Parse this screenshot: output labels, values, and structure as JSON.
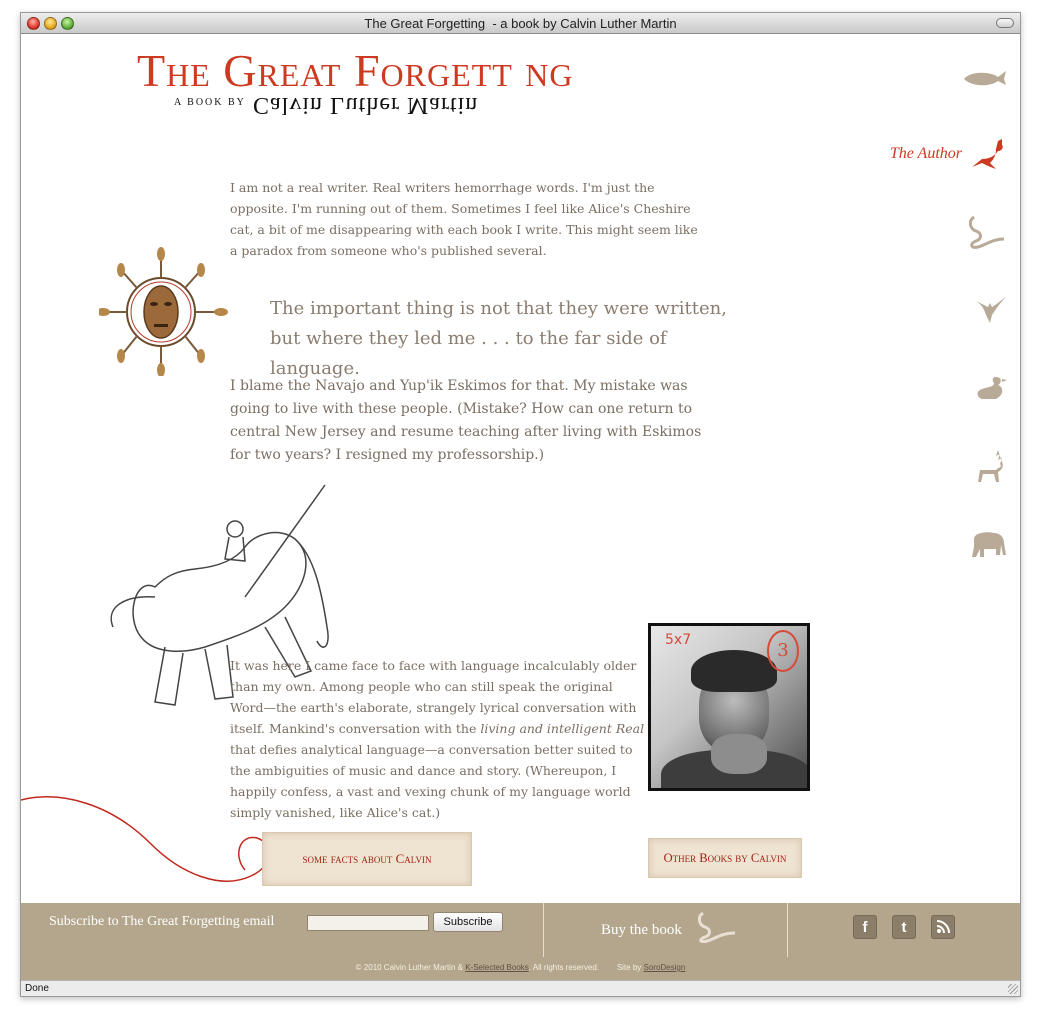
{
  "window": {
    "title": "The Great Forgetting  - a book by Calvin Luther Martin",
    "status": "Done"
  },
  "header": {
    "title": "The Great Forgett ng",
    "byline_small": "A BOOK BY",
    "byline_author": "Calvin Luther Martin"
  },
  "content": {
    "paragraph1": "I am not a real writer. Real writers hemorrhage words. I'm just the opposite. I'm running out of them. Sometimes I feel like Alice's Cheshire cat, a bit of me disappearing with each book I write. This might seem like a paradox from someone who's published several.",
    "quote_line1": "The important thing is not that they were written,",
    "quote_line2": "but where they led me . . . to the far side of language.",
    "paragraph2": "I blame the Navajo and Yup'ik Eskimos for that. My mistake was going to live with these people. (Mistake? How can one return to central New Jersey and resume teaching after living with Eskimos for two years? I resigned my professorship.)",
    "paragraph3_a": "It was here I came face to face with language incalculably older than my own. Among people who can still speak the original Word—the earth's elaborate, strangely lyrical conversation with itself. Mankind's conversation with the ",
    "paragraph3_em": "living and intelligent Real",
    "paragraph3_b": " that defies analytical language—a conversation better suited to the ambiguities of music and dance and story. (Whereupon, I happily confess, a vast and vexing chunk of my language world simply vanished, like Alice's cat.)",
    "photo_mark_size": "5x7",
    "photo_mark_number": "3"
  },
  "nav": {
    "active_label": "The Author",
    "icons": [
      "whale-icon",
      "kangaroo-icon",
      "snake-icon",
      "bat-icon",
      "duck-icon",
      "caribou-icon",
      "elephant-icon"
    ]
  },
  "links": {
    "facts": "some facts about Calvin",
    "other_books": "Other Books by Calvin"
  },
  "footer": {
    "subscribe_label": "Subscribe to The Great Forgetting email",
    "subscribe_input_value": "",
    "subscribe_button": "Subscribe",
    "buy_label": "Buy the book",
    "copyright_prefix": "© 2010 Calvin Luther Martin & ",
    "copyright_link": "K-Selected Books",
    "copyright_suffix": ". All rights reserved.",
    "site_by_prefix": "Site by ",
    "site_by_link": "SoroDesign"
  },
  "colors": {
    "accent_red": "#cc3a22",
    "body_text": "#7a6e63",
    "footer_bg": "#b3a68c",
    "nav_icon": "#b9aa98"
  }
}
